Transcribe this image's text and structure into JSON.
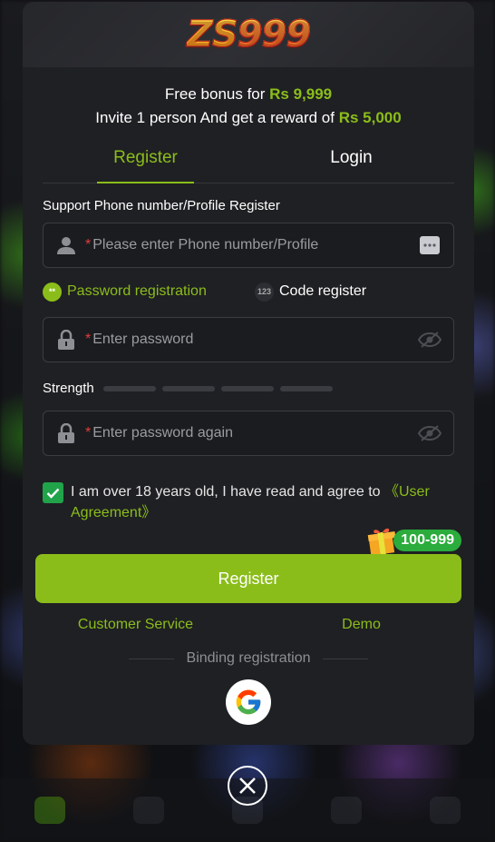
{
  "logo": {
    "text": "ZS",
    "digits": "999"
  },
  "promo": {
    "line1_prefix": "Free bonus for ",
    "line1_amount": "Rs 9,999",
    "line2_prefix": "Invite 1 person And get a reward of ",
    "line2_amount": "Rs 5,000"
  },
  "tabs": [
    {
      "label": "Register",
      "active": true
    },
    {
      "label": "Login",
      "active": false
    }
  ],
  "phone": {
    "label": "Support Phone number/Profile Register",
    "required_mark": "*",
    "placeholder": "Please enter Phone number/Profile",
    "value": ""
  },
  "modes": {
    "password_label": "Password registration",
    "password_icon_text": "**",
    "code_label": "Code register",
    "code_icon_text": "123"
  },
  "password": {
    "required_mark": "*",
    "placeholder": "Enter password",
    "value": ""
  },
  "strength": {
    "label": "Strength",
    "level": 0,
    "segments": 4
  },
  "password_confirm": {
    "required_mark": "*",
    "placeholder": "Enter password again",
    "value": ""
  },
  "agreement": {
    "checked": true,
    "text": "I am over 18 years old, I have read and agree to ",
    "link": "《User Agreement》"
  },
  "gift": {
    "badge": "100-999"
  },
  "register_button": "Register",
  "links": {
    "customer_service": "Customer Service",
    "demo": "Demo"
  },
  "binding_label": "Binding registration",
  "colors": {
    "accent": "#8bbd1a",
    "check": "#21a34a",
    "required": "#e03d3d",
    "badge": "#2bac3c"
  },
  "icons": [
    "user-icon",
    "keyboard-icon",
    "lock-icon",
    "eye-off-icon",
    "check-icon",
    "gift-icon",
    "google-icon",
    "close-icon"
  ]
}
